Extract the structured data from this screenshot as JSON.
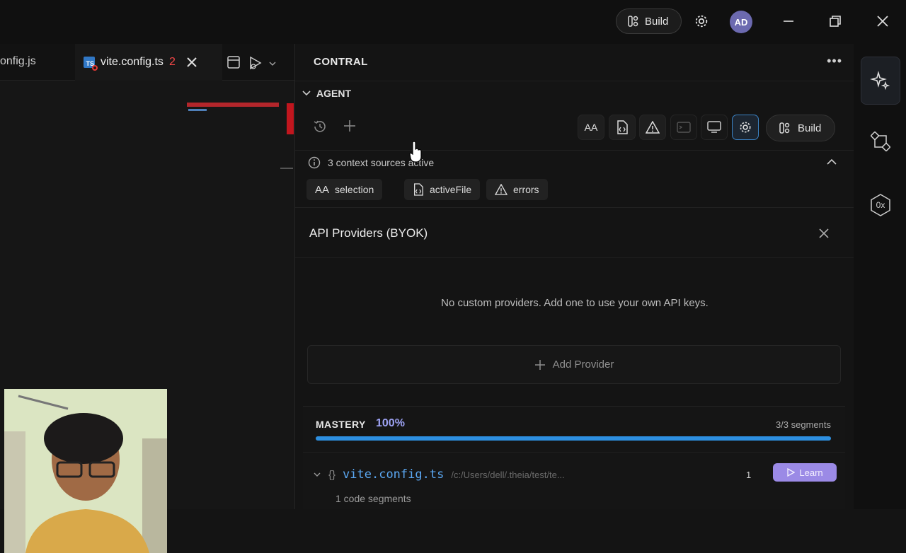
{
  "titlebar": {
    "build_label": "Build",
    "avatar_initials": "AD"
  },
  "editor": {
    "prev_tab_label": "onfig.js",
    "active_tab_label": "vite.config.ts",
    "active_tab_problem_count": "2"
  },
  "panel": {
    "title": "CONTRAL",
    "agent_section_label": "AGENT",
    "toolbar": {
      "build_label": "Build",
      "font_button_label": "AA"
    },
    "context": {
      "summary": "3 context sources active",
      "chips": [
        {
          "label": "selection",
          "icon": "font-size-icon"
        },
        {
          "label": "activeFile",
          "icon": "file-code-icon"
        },
        {
          "label": "errors",
          "icon": "warning-icon"
        }
      ]
    },
    "byok": {
      "title": "API Providers (BYOK)",
      "empty_message": "No custom providers. Add one to use your own API keys.",
      "add_label": "Add Provider"
    },
    "mastery": {
      "label": "MASTERY",
      "percent_text": "100%",
      "progress": 1.0,
      "segments_text": "3/3 segments",
      "file": {
        "name": "vite.config.ts",
        "path": "/c:/Users/dell/.theia/test/te...",
        "count": "1",
        "learn_label": "Learn"
      },
      "sub_text": "1 code segments"
    }
  },
  "rail": {
    "third_icon_text": "0x"
  },
  "colors": {
    "accent_blue": "#2d8fe0",
    "accent_purple": "#9ea3f5",
    "learn_button": "#9b8ae6",
    "error_red": "#f44747"
  }
}
